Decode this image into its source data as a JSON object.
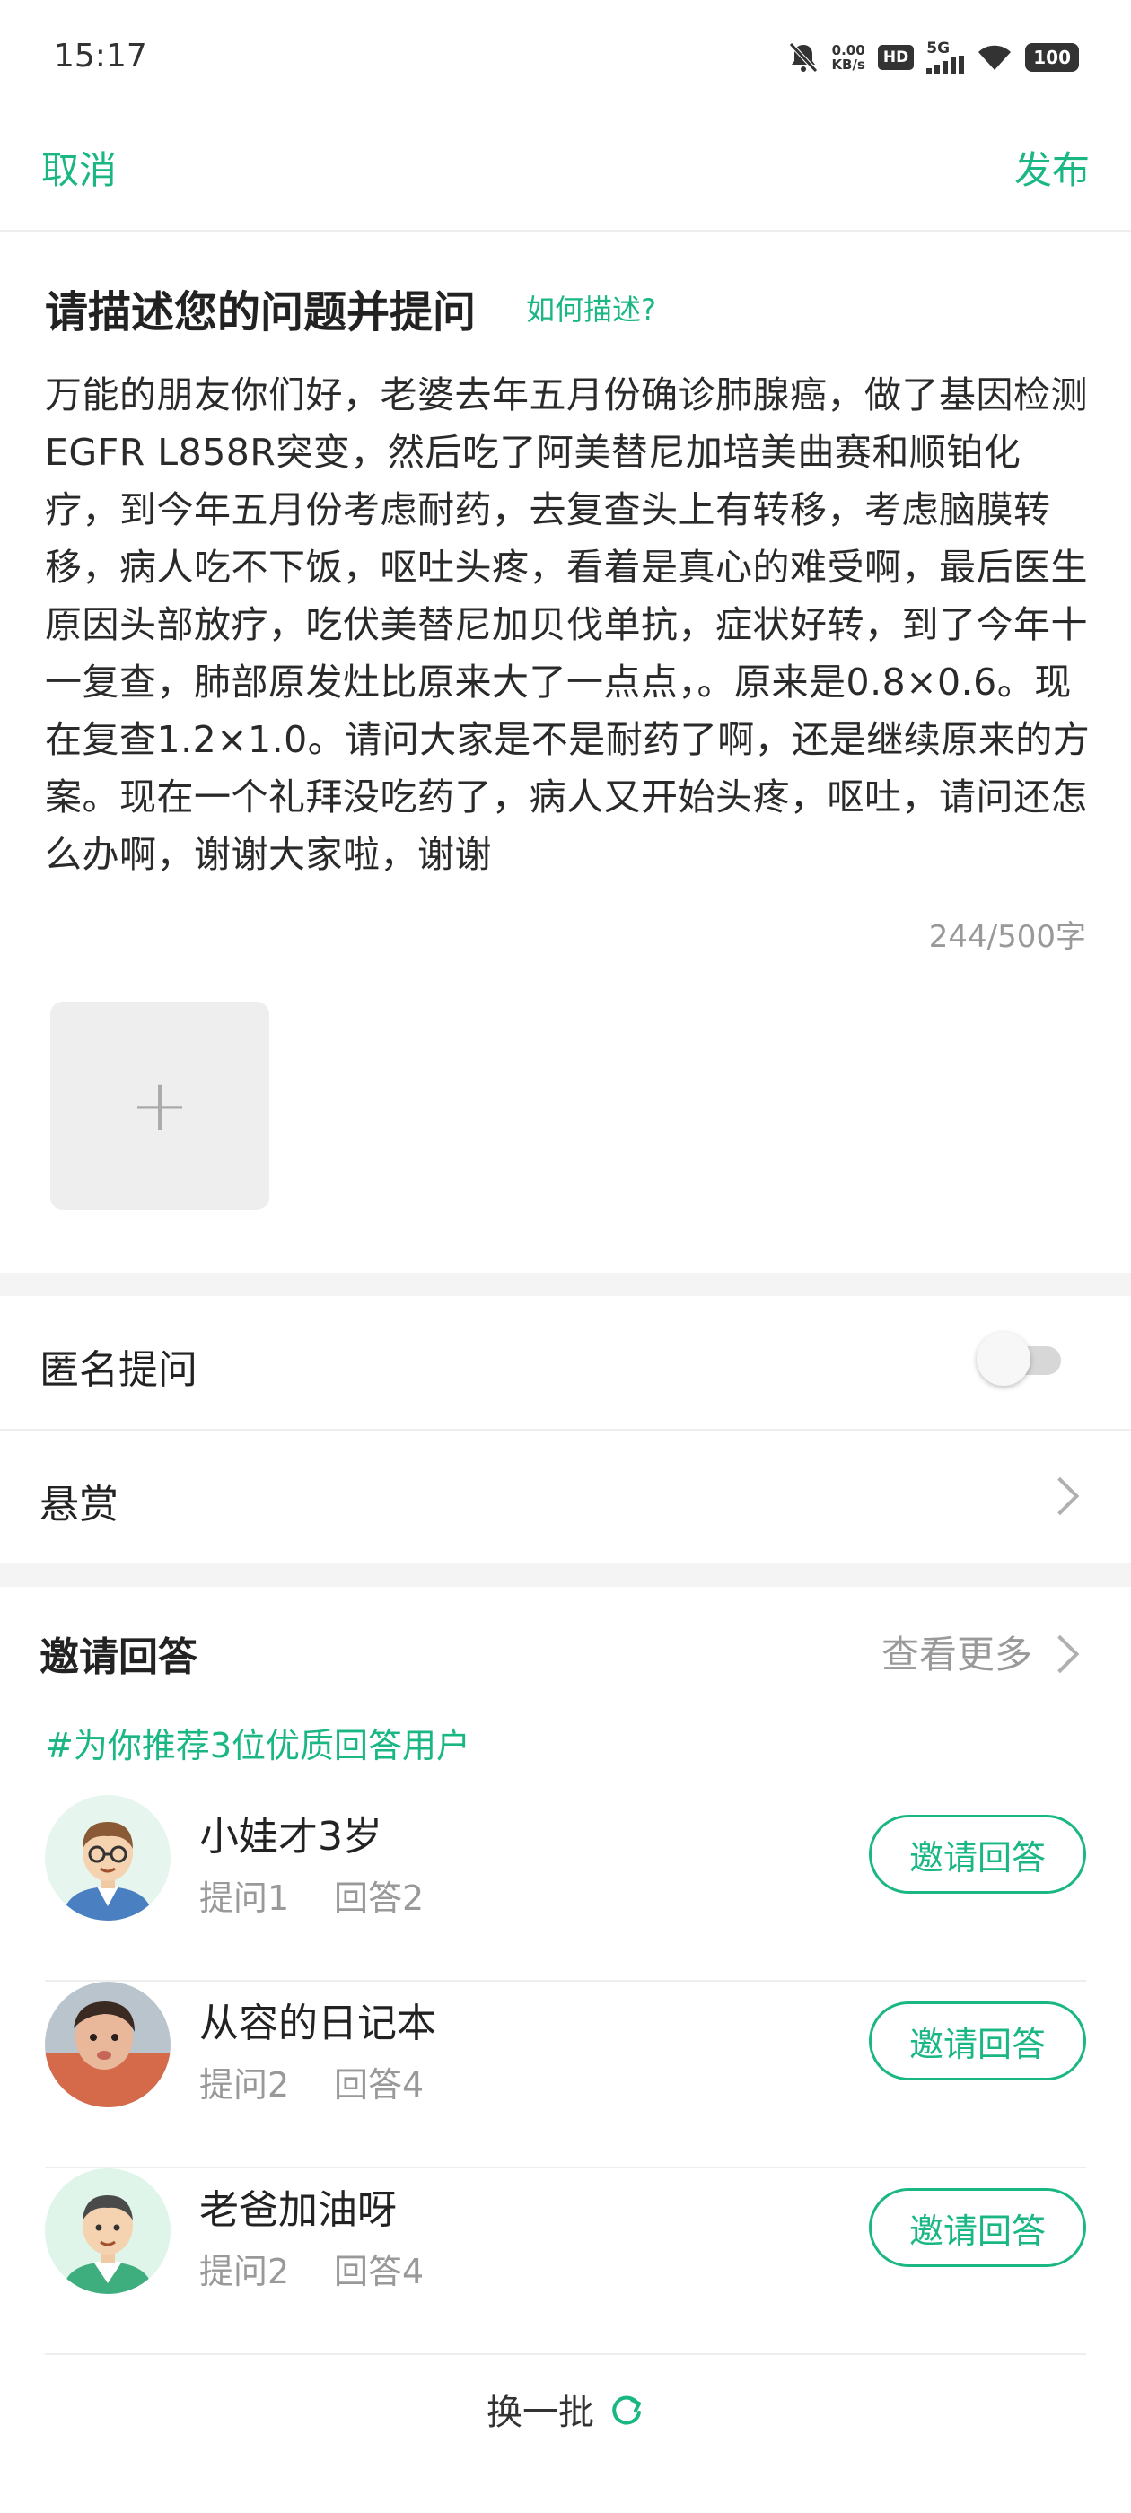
{
  "status_bar": {
    "time": "15:17",
    "net_speed_value": "0.00",
    "net_speed_unit": "KB/s",
    "hd_badge": "HD",
    "network": "5G",
    "battery": "100"
  },
  "header": {
    "cancel_label": "取消",
    "publish_label": "发布"
  },
  "question": {
    "title": "请描述您的问题并提问",
    "help_link": "如何描述?",
    "body": "万能的朋友你们好，老婆去年五月份确诊肺腺癌，做了基因检测EGFR  L858R突变，然后吃了阿美替尼加培美曲赛和顺铂化疗，到今年五月份考虑耐药，去复查头上有转移，考虑脑膜转移，病人吃不下饭，呕吐头疼，看着是真心的难受啊，最后医生原因头部放疗，吃伏美替尼加贝伐单抗，症状好转，到了今年十一复查，肺部原发灶比原来大了一点点，。原来是0.8×0.6。现在复查1.2×1.0。请问大家是不是耐药了啊，还是继续原来的方案。现在一个礼拜没吃药了，病人又开始头疼，呕吐，请问还怎么办啊，谢谢大家啦，谢谢",
    "char_count": "244/500字",
    "add_photo_symbol": "+"
  },
  "options": {
    "anonymous_label": "匿名提问",
    "anonymous_enabled": false,
    "reward_label": "悬赏"
  },
  "invite": {
    "title": "邀请回答",
    "see_more": "查看更多",
    "recommend_text": "#为你推荐3位优质回答用户",
    "button_label": "邀请回答",
    "users": [
      {
        "name": "小娃才3岁",
        "questions": "提问1",
        "answers": "回答2"
      },
      {
        "name": "从容的日记本",
        "questions": "提问2",
        "answers": "回答4"
      },
      {
        "name": "老爸加油呀",
        "questions": "提问2",
        "answers": "回答4"
      }
    ],
    "refresh_label": "换一批"
  },
  "colors": {
    "accent": "#1ab785",
    "divider": "#eeeeee",
    "muted_text": "#999999",
    "section_gap": "#f4f4f4"
  },
  "icons": {
    "mute": "bell-off-icon",
    "wifi": "wifi-icon",
    "battery": "battery-icon",
    "chevron": "chevron-right-icon",
    "refresh": "refresh-icon",
    "add": "plus-icon"
  }
}
